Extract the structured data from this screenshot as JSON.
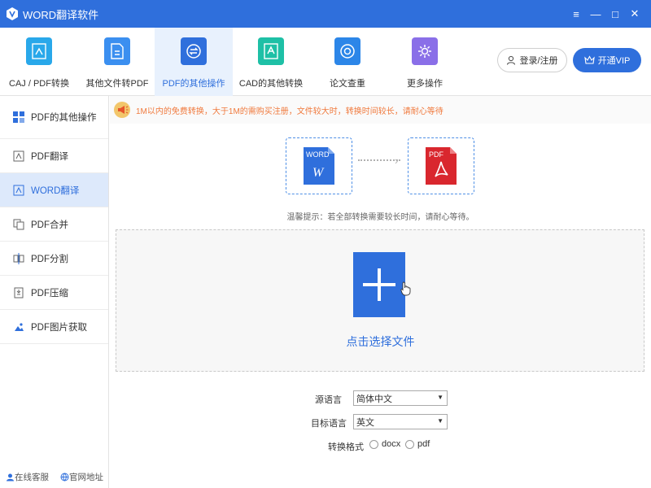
{
  "window": {
    "title": "WORD翻译软件",
    "controls": [
      "≡",
      "—",
      "□",
      "✕"
    ]
  },
  "toolbar": {
    "items": [
      {
        "label": "CAJ / PDF转换",
        "icon": "caj-pdf-convert-icon",
        "color": "#29a8ea"
      },
      {
        "label": "其他文件转PDF",
        "icon": "file-to-pdf-icon",
        "color": "#3b8ff0"
      },
      {
        "label": "PDF的其他操作",
        "icon": "pdf-operations-icon",
        "color": "#2f6fdc"
      },
      {
        "label": "CAD的其他转换",
        "icon": "cad-convert-icon",
        "color": "#1ec0a6"
      },
      {
        "label": "论文查重",
        "icon": "paper-check-icon",
        "color": "#2c86e8"
      },
      {
        "label": "更多操作",
        "icon": "more-operations-icon",
        "color": "#8a6fe8"
      }
    ],
    "active_index": 2,
    "login_label": "登录/注册",
    "vip_label": "开通VIP"
  },
  "sidebar": {
    "items": [
      {
        "label": "PDF的其他操作",
        "icon": "grid-icon"
      },
      {
        "label": "PDF翻译",
        "icon": "pdf-translate-icon"
      },
      {
        "label": "WORD翻译",
        "icon": "word-translate-icon"
      },
      {
        "label": "PDF合并",
        "icon": "pdf-merge-icon"
      },
      {
        "label": "PDF分割",
        "icon": "pdf-split-icon"
      },
      {
        "label": "PDF压缩",
        "icon": "pdf-compress-icon"
      },
      {
        "label": "PDF图片获取",
        "icon": "pdf-image-icon"
      }
    ],
    "active_index": 2,
    "footer": {
      "service_label": "在线客服",
      "website_label": "官网地址"
    }
  },
  "notice": {
    "text": "1M以内的免费转换，大于1M的需购买注册，文件较大时，转换时间较长，请耐心等待"
  },
  "conversion": {
    "from_label": "WORD",
    "from_letter": "W",
    "to_label": "PDF",
    "hint": "温馨提示：若全部转换需要较长时间，请耐心等待。"
  },
  "upload": {
    "select_label": "点击选择文件"
  },
  "form": {
    "source_language_label": "源语言",
    "source_language_value": "简体中文",
    "target_language_label": "目标语言",
    "target_language_value": "英文",
    "format_label": "转换格式",
    "format_options": [
      "docx",
      "pdf"
    ]
  },
  "colors": {
    "accent": "#2f6fdc",
    "notice": "#f07a3e",
    "pdf_red": "#d9272e"
  }
}
